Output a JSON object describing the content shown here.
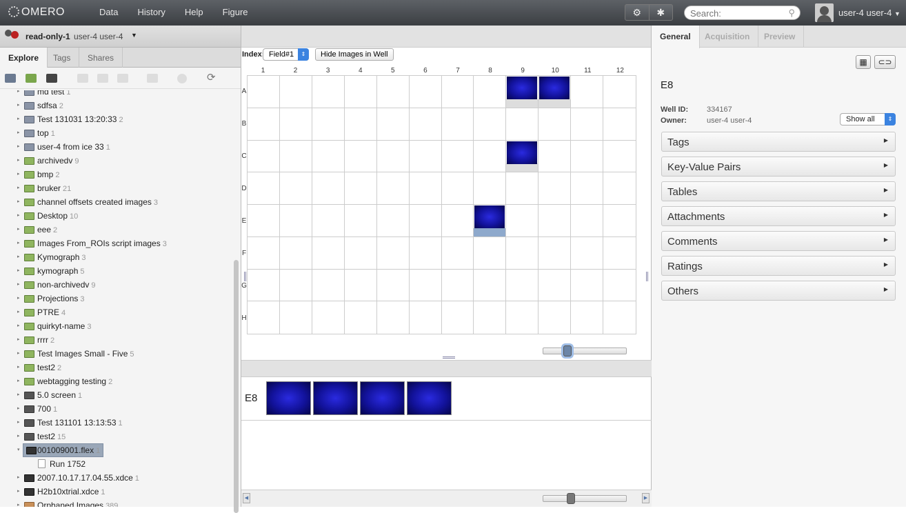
{
  "app": {
    "logo_text": "OMERO"
  },
  "nav": [
    "Data",
    "History",
    "Help",
    "Figure"
  ],
  "toolbar_icons": [
    "settings-gear-icon",
    "scripts-stars-icon"
  ],
  "search": {
    "placeholder": "Search:"
  },
  "user": {
    "display_name": "user-4 user-4"
  },
  "group": {
    "name": "read-only-1",
    "user": "user-4 user-4"
  },
  "left_tabs": [
    "Explore",
    "Tags",
    "Shares"
  ],
  "left_tools": [
    "new-project-icon",
    "new-dataset-icon",
    "new-screen-icon",
    "cut-icon",
    "copy-icon",
    "paste-icon",
    "delete-icon",
    "share-icon",
    "refresh-icon"
  ],
  "tree": [
    {
      "label": "md test",
      "count": "1",
      "type": "proj"
    },
    {
      "label": "sdfsa",
      "count": "2",
      "type": "proj"
    },
    {
      "label": "Test 131031 13:20:33",
      "count": "2",
      "type": "proj"
    },
    {
      "label": "top",
      "count": "1",
      "type": "proj"
    },
    {
      "label": "user-4 from ice 33",
      "count": "1",
      "type": "proj"
    },
    {
      "label": "archivedv",
      "count": "9",
      "type": "ds"
    },
    {
      "label": "bmp",
      "count": "2",
      "type": "ds"
    },
    {
      "label": "bruker",
      "count": "21",
      "type": "ds"
    },
    {
      "label": "channel offsets created images",
      "count": "3",
      "type": "ds"
    },
    {
      "label": "Desktop",
      "count": "10",
      "type": "ds"
    },
    {
      "label": "eee",
      "count": "2",
      "type": "ds"
    },
    {
      "label": "Images From_ROIs script images",
      "count": "3",
      "type": "ds"
    },
    {
      "label": "Kymograph",
      "count": "3",
      "type": "ds"
    },
    {
      "label": "kymograph",
      "count": "5",
      "type": "ds"
    },
    {
      "label": "non-archivedv",
      "count": "9",
      "type": "ds"
    },
    {
      "label": "Projections",
      "count": "3",
      "type": "ds"
    },
    {
      "label": "PTRE",
      "count": "4",
      "type": "ds"
    },
    {
      "label": "quirkyt-name",
      "count": "3",
      "type": "ds"
    },
    {
      "label": "rrrr",
      "count": "2",
      "type": "ds"
    },
    {
      "label": "Test Images Small - Five",
      "count": "5",
      "type": "ds"
    },
    {
      "label": "test2",
      "count": "2",
      "type": "ds"
    },
    {
      "label": "webtagging testing",
      "count": "2",
      "type": "ds"
    },
    {
      "label": "5.0 screen",
      "count": "1",
      "type": "scr"
    },
    {
      "label": "700",
      "count": "1",
      "type": "scr"
    },
    {
      "label": "Test 131101 13:13:53",
      "count": "1",
      "type": "scr"
    },
    {
      "label": "test2",
      "count": "15",
      "type": "scr"
    },
    {
      "label": "001009001.flex",
      "count": "1",
      "type": "plate",
      "selected": true,
      "expanded": true
    },
    {
      "label": "Run 1752",
      "count": "",
      "type": "run"
    },
    {
      "label": "2007.10.17.17.04.55.xdce",
      "count": "1",
      "type": "plate"
    },
    {
      "label": "H2b10xtrial.xdce",
      "count": "1",
      "type": "plate"
    },
    {
      "label": "Orphaned Images",
      "count": "389",
      "type": "orph"
    }
  ],
  "center": {
    "index_label": "Index:",
    "field_value": "Field#1",
    "hide_button": "Hide Images in Well",
    "columns": [
      "1",
      "2",
      "3",
      "4",
      "5",
      "6",
      "7",
      "8",
      "9",
      "10",
      "11",
      "12"
    ],
    "rows": [
      "A",
      "B",
      "C",
      "D",
      "E",
      "F",
      "G",
      "H"
    ],
    "filled_wells": [
      {
        "row": 0,
        "col": 8,
        "selected": false
      },
      {
        "row": 0,
        "col": 9,
        "selected": false
      },
      {
        "row": 2,
        "col": 8,
        "selected": false
      },
      {
        "row": 4,
        "col": 7,
        "selected": true
      }
    ],
    "zoom_level_top": 0.29,
    "zoom_level_bottom": 0.33,
    "well_label": "E8",
    "well_image_count": 4
  },
  "right": {
    "tabs": [
      "General",
      "Acquisition",
      "Preview"
    ],
    "title": "E8",
    "well_id_label": "Well ID:",
    "well_id": "334167",
    "owner_label": "Owner:",
    "owner": "user-4 user-4",
    "show_all": "Show all",
    "sections": [
      "Tags",
      "Key-Value Pairs",
      "Tables",
      "Attachments",
      "Comments",
      "Ratings",
      "Others"
    ]
  }
}
